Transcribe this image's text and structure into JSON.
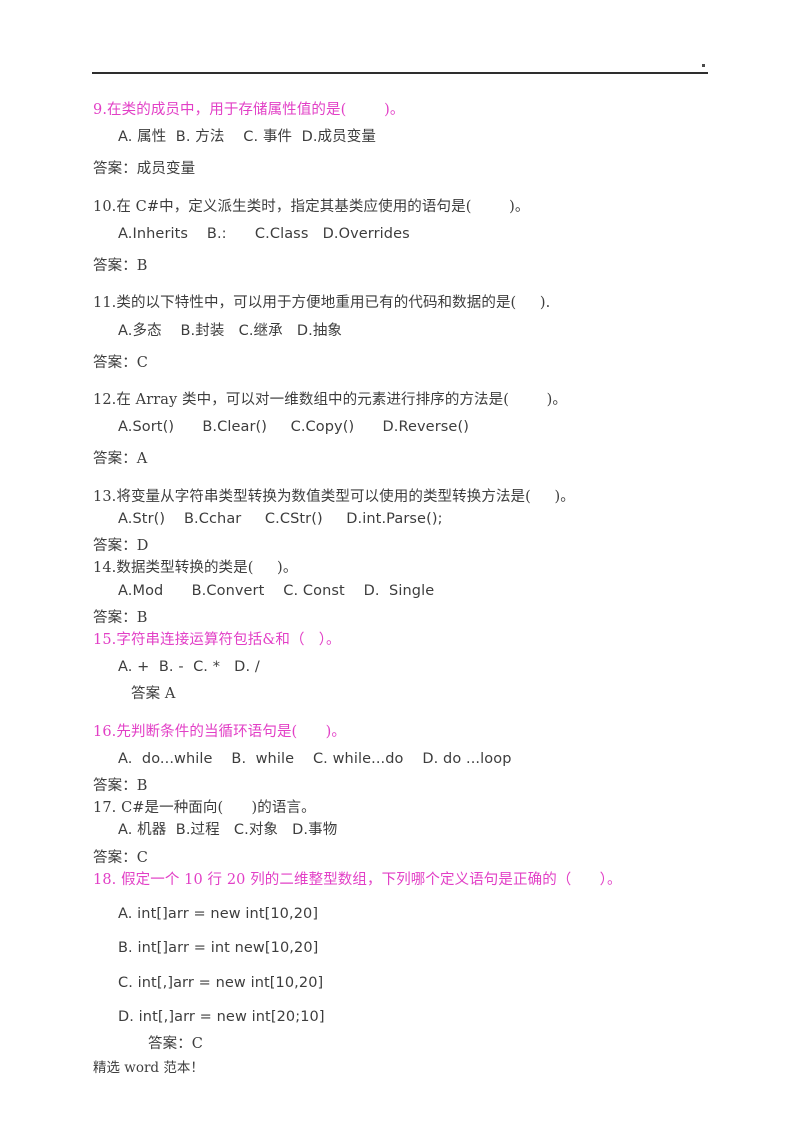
{
  "document": {
    "header_rule": true,
    "header_dot": ".",
    "footer_note": "精选 word 范本！",
    "accent_color": "#e23fc6",
    "text_color": "#3d3d3d"
  },
  "questions": [
    {
      "number": "9.",
      "color": "magenta",
      "stem": "9.在类的成员中，用于存储属性值的是(        )。",
      "options_line": "A. 属性  B. 方法    C. 事件  D.成员变量",
      "answer_line": "答案：成员变量"
    },
    {
      "number": "10.",
      "color": "black",
      "stem": "10.在 C#中，定义派生类时，指定其基类应使用的语句是(        )。",
      "options_line": "A.Inherits    B.:      C.Class   D.Overrides",
      "answer_line": "答案：B"
    },
    {
      "number": "11.",
      "color": "black",
      "stem": "11.类的以下特性中，可以用于方便地重用已有的代码和数据的是(     ).",
      "options_line": "A.多态    B.封装   C.继承   D.抽象",
      "answer_line": "答案：C"
    },
    {
      "number": "12.",
      "color": "black",
      "stem": "12.在 Array 类中，可以对一维数组中的元素进行排序的方法是(        )。",
      "options_line": "A.Sort()      B.Clear()     C.Copy()      D.Reverse()",
      "answer_line": "答案：A"
    },
    {
      "number": "13.",
      "color": "black",
      "stem": "13.将变量从字符串类型转换为数值类型可以使用的类型转换方法是(     )。",
      "options_line": "A.Str()    B.Cchar     C.CStr()     D.int.Parse();",
      "answer_line": "答案：D"
    },
    {
      "number": "14.",
      "color": "black",
      "stem": "14.数据类型转换的类是(     )。",
      "options_line": "A.Mod      B.Convert    C. Const    D.  Single",
      "answer_line": "答案：B"
    },
    {
      "number": "15.",
      "color": "magenta",
      "stem": "15.字符串连接运算符包括&和（   ）。",
      "options_line": "A. +  B. -  C. *   D. /",
      "answer_line": "答案 A"
    },
    {
      "number": "16.",
      "color": "magenta",
      "stem": "16.先判断条件的当循环语句是(      )。",
      "options_line": "A.  do...while    B.  while    C. while...do    D. do ...loop",
      "answer_line": "答案：B"
    },
    {
      "number": "17.",
      "color": "black",
      "stem": "17. C#是一种面向(      )的语言。",
      "options_line": "A. 机器  B.过程   C.对象   D.事物",
      "answer_line": "答案：C"
    },
    {
      "number": "18.",
      "color": "magenta",
      "stem": "18. 假定一个 10 行 20 列的二维整型数组，下列哪个定义语句是正确的（      ）。",
      "options": [
        "A. int[]arr = new int[10,20]",
        "B. int[]arr = int new[10,20]",
        "C. int[,]arr = new int[10,20]",
        "D. int[,]arr = new int[20;10]"
      ],
      "answer_line": "答案：C"
    }
  ]
}
